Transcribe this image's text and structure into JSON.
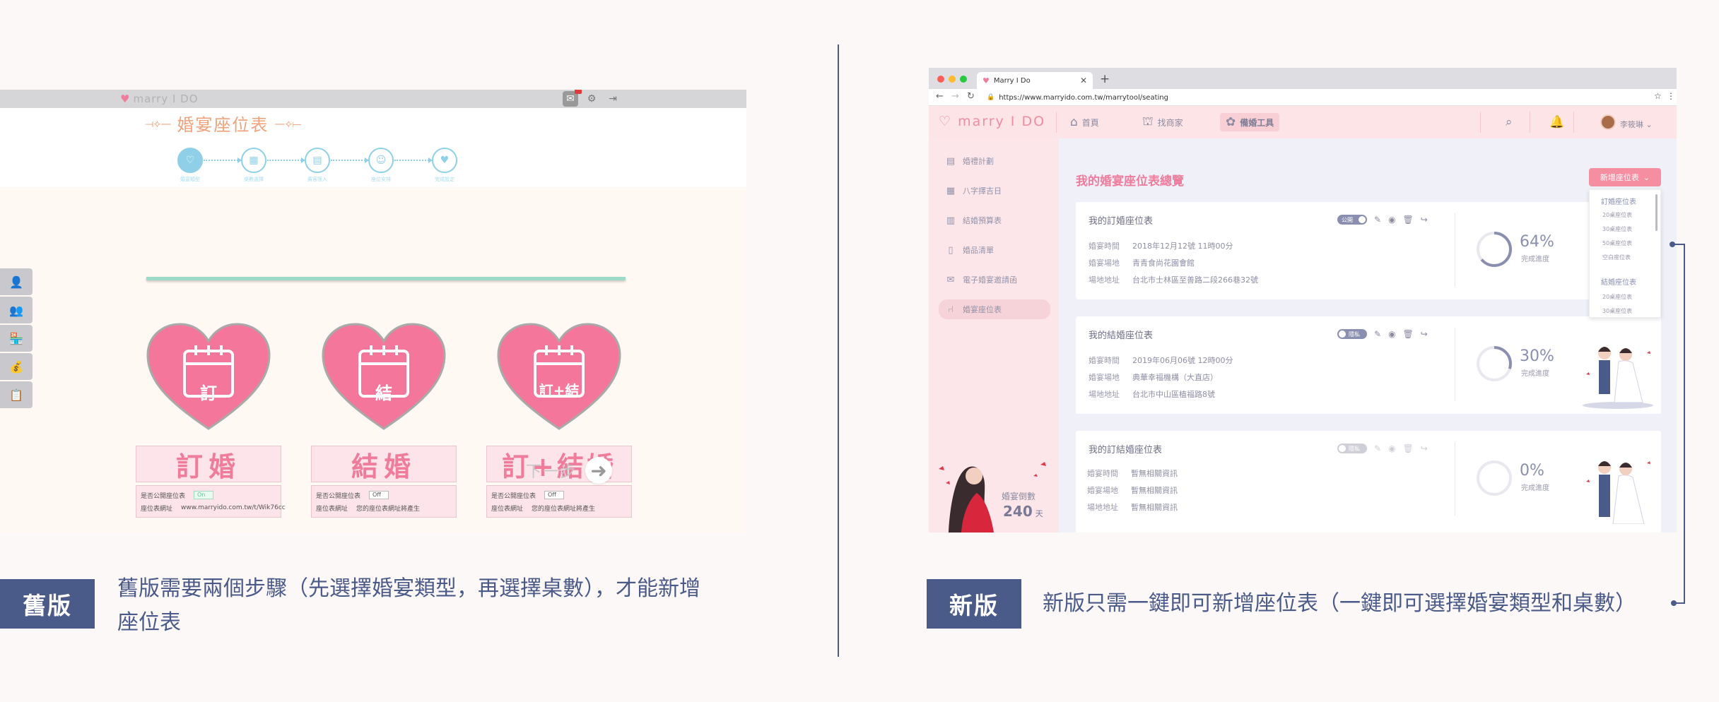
{
  "old_version": {
    "badge": "舊版",
    "description_line1": "舊版需要兩個步驟（先選擇婚宴類型，再選擇桌數），才能新增",
    "description_line2": "座位表",
    "logo": "marry I DO",
    "title": "婚宴座位表",
    "steps": [
      "婚宴類型",
      "桌數選擇",
      "賓客匯入",
      "座位安排",
      "完成設定"
    ],
    "cards": [
      {
        "icon_label": "訂",
        "name": "訂婚",
        "public_label": "是否公開座位表",
        "public_state": "On",
        "url_label": "座位表網址",
        "url_value": "www.marryido.com.tw/t/Wik76cc"
      },
      {
        "icon_label": "結",
        "name": "結婚",
        "public_label": "是否公開座位表",
        "public_state": "Off",
        "url_label": "座位表網址",
        "url_value": "您的座位表網址將產生"
      },
      {
        "icon_label": "訂+結",
        "name": "訂+結婚",
        "public_label": "是否公開座位表",
        "public_state": "Off",
        "url_label": "座位表網址",
        "url_value": "您的座位表網址將產生"
      }
    ],
    "next_label": "下一步"
  },
  "new_version": {
    "badge": "新版",
    "description": "新版只需一鍵即可新增座位表（一鍵即可選擇婚宴類型和桌數）",
    "browser": {
      "tab_title": "Marry I Do",
      "url": "https://www.marryido.com.tw/marrytool/seating"
    },
    "site": {
      "logo": "marry I DO",
      "nav": [
        {
          "label": "首頁",
          "icon": "home-icon"
        },
        {
          "label": "找商家",
          "icon": "shop-icon"
        },
        {
          "label": "備婚工具",
          "icon": "tools-icon"
        }
      ],
      "user_name": "李筱琳"
    },
    "sidebar": [
      {
        "label": "婚禮計劃"
      },
      {
        "label": "八字擇吉日"
      },
      {
        "label": "結婚預算表"
      },
      {
        "label": "婚品清單"
      },
      {
        "label": "電子婚宴邀請函"
      },
      {
        "label": "婚宴座位表"
      }
    ],
    "countdown": {
      "label": "婚宴倒數",
      "days": "240",
      "unit": "天"
    },
    "overview_title": "我的婚宴座位表總覽",
    "add_button": "新增座位表",
    "dropdown": {
      "groups": [
        {
          "title": "訂婚座位表",
          "options": [
            "20桌座位表",
            "30桌座位表",
            "50桌座位表",
            "空白座位表"
          ]
        },
        {
          "title": "結婚座位表",
          "options": [
            "20桌座位表",
            "30桌座位表"
          ]
        }
      ]
    },
    "cards": [
      {
        "title": "我的訂婚座位表",
        "toggle": "公開",
        "time_label": "婚宴時間",
        "time": "2018年12月12號  11時00分",
        "venue_label": "婚宴場地",
        "venue": "青青食尚花園會館",
        "addr_label": "場地地址",
        "addr": "台北市士林區至善路二段266巷32號",
        "percent": "64%",
        "progress": 0.64,
        "progress_label": "完成進度"
      },
      {
        "title": "我的結婚座位表",
        "toggle": "隱私",
        "time_label": "婚宴時間",
        "time": "2019年06月06號  12時00分",
        "venue_label": "婚宴場地",
        "venue": "典華幸福機構（大直店）",
        "addr_label": "場地地址",
        "addr": "台北市中山區植福路8號",
        "percent": "30%",
        "progress": 0.3,
        "progress_label": "完成進度"
      },
      {
        "title": "我的訂結婚座位表",
        "toggle": "隱私",
        "time_label": "婚宴時間",
        "time": "暫無相關資訊",
        "venue_label": "婚宴場地",
        "venue": "暫無相關資訊",
        "addr_label": "場地地址",
        "addr": "暫無相關資訊",
        "percent": "0%",
        "progress": 0.0,
        "progress_label": "完成進度"
      }
    ]
  },
  "colors": {
    "accent": "#f07c9c",
    "navy": "#4a5a89",
    "step_blue": "#8fd0e8"
  }
}
